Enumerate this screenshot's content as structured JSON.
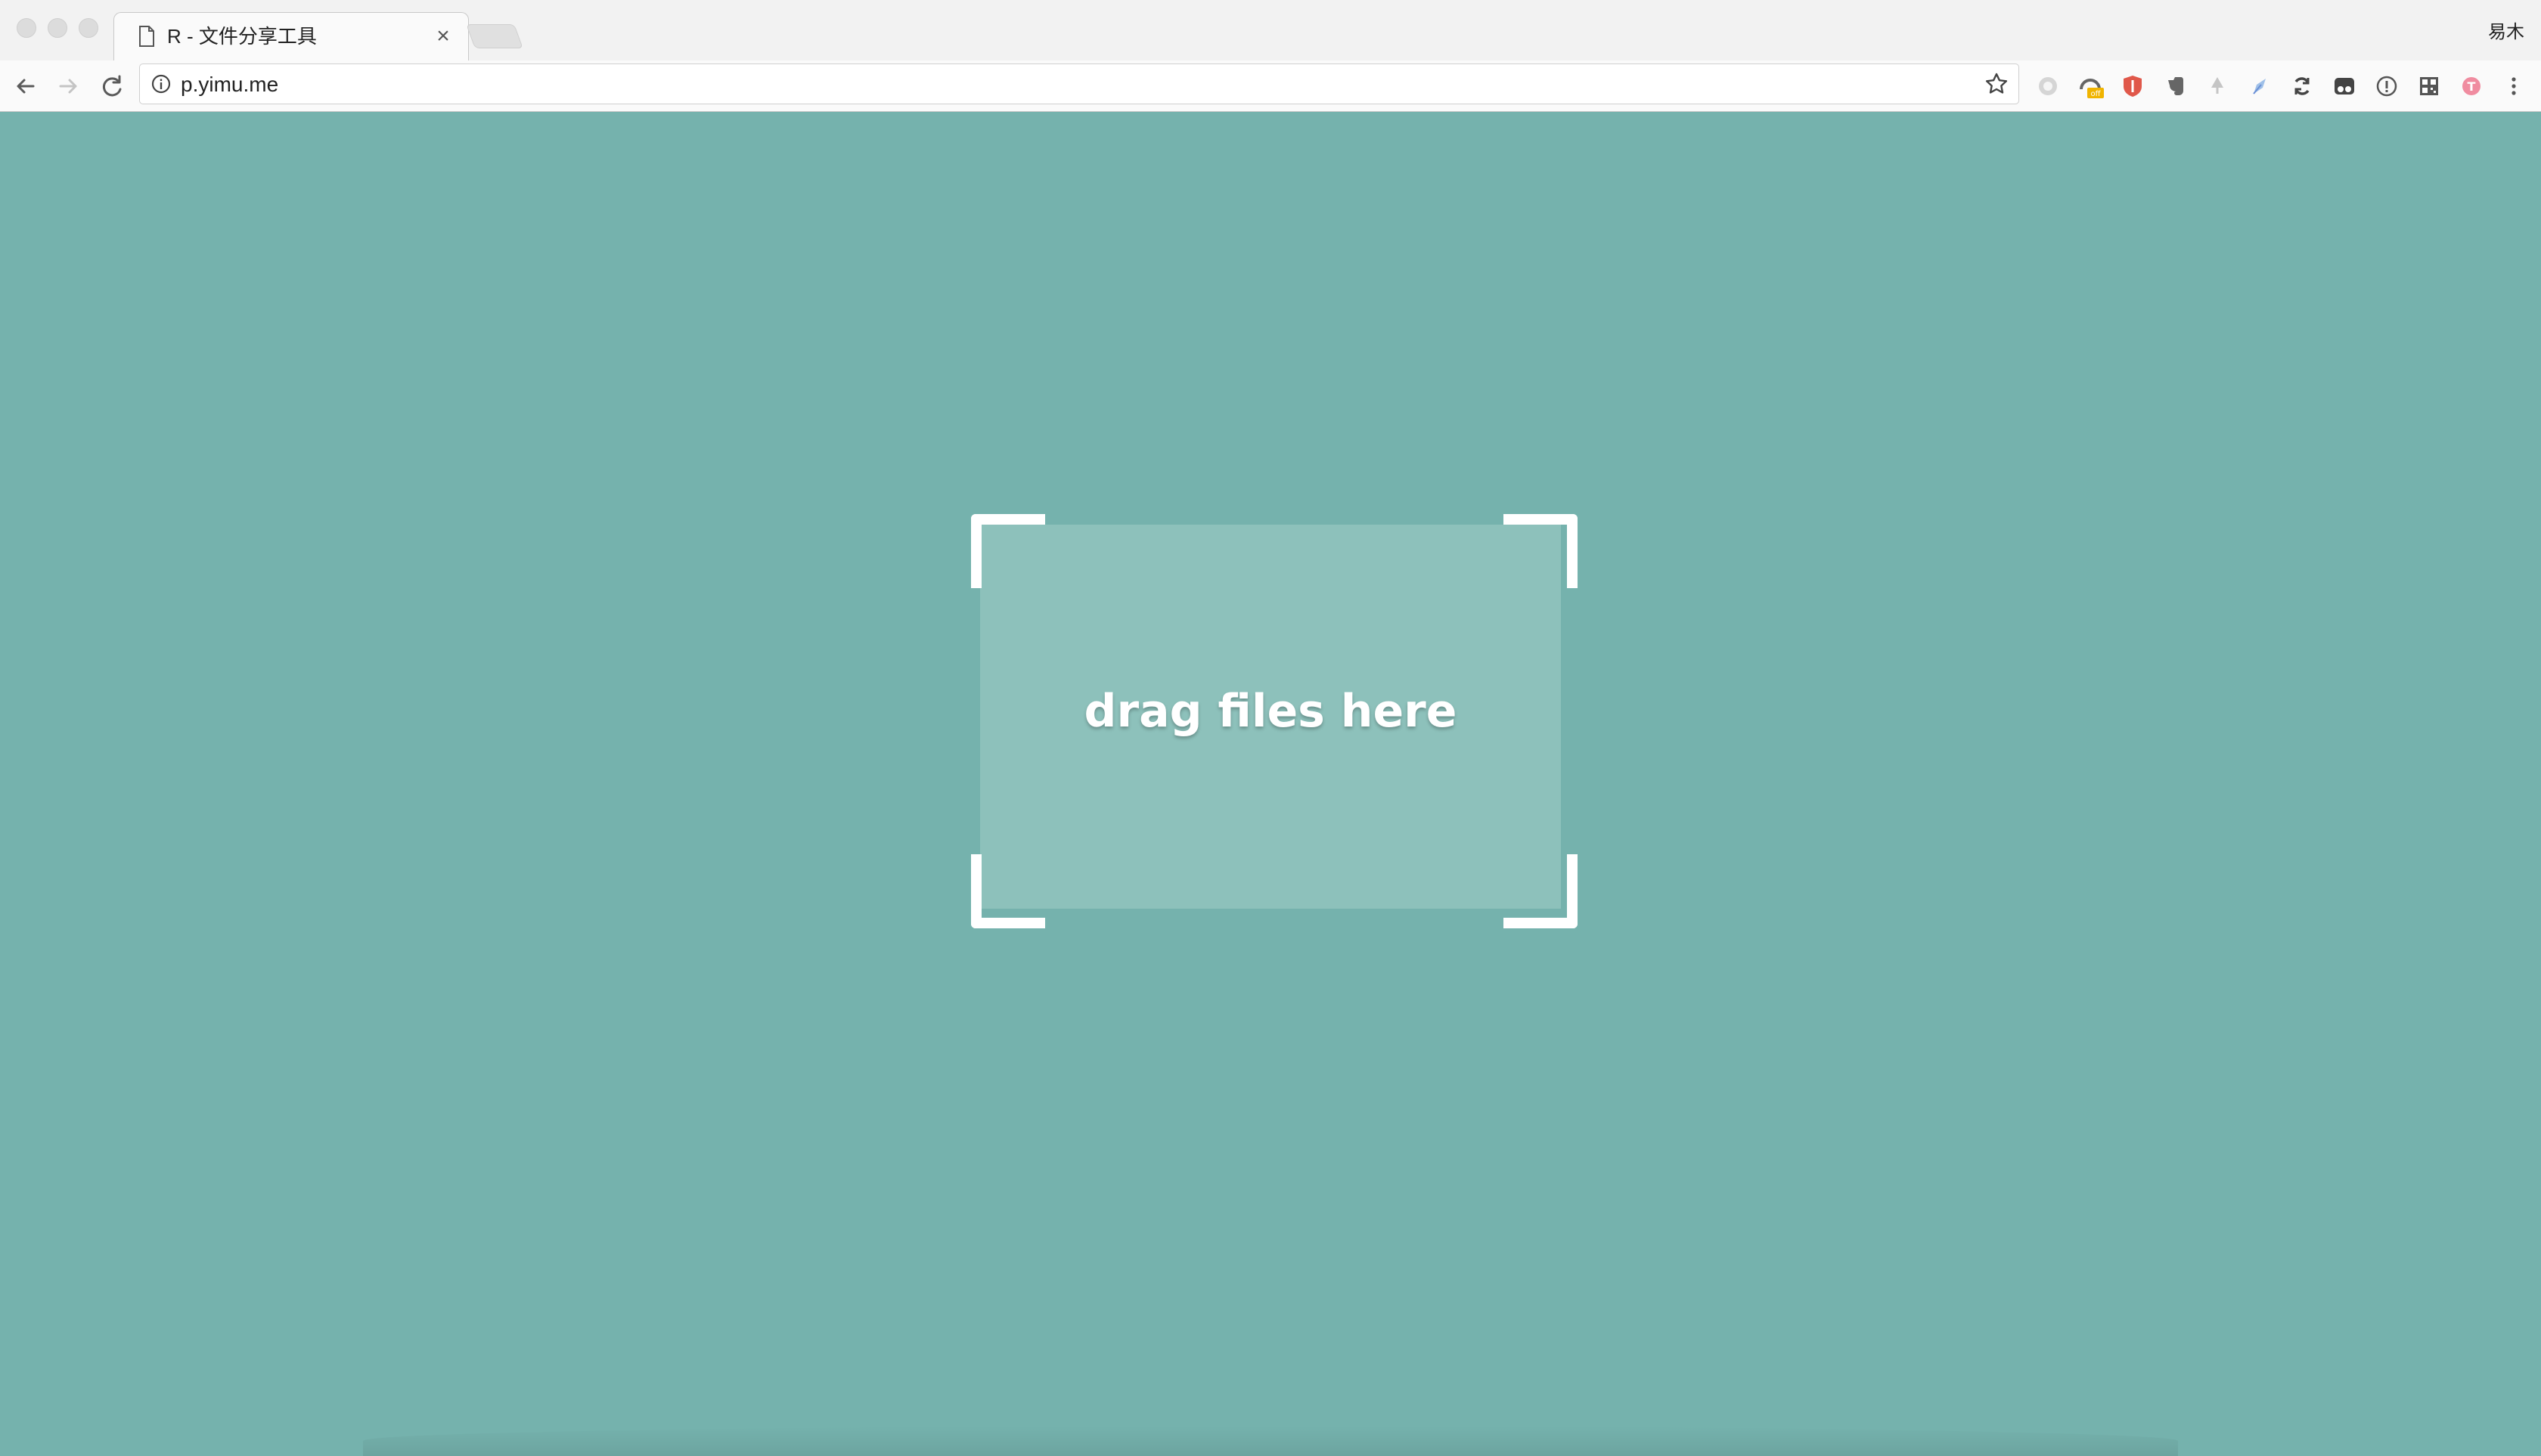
{
  "browser": {
    "tab": {
      "title": "R - 文件分享工具",
      "close_glyph": "×"
    },
    "profile_name": "易木",
    "address_bar": {
      "url": "p.yimu.me"
    },
    "extensions": [
      {
        "name": "circle-extension-icon",
        "color": "#b5b5b5"
      },
      {
        "name": "off-badge-extension-icon",
        "color": "#f0b400",
        "badge": "off"
      },
      {
        "name": "shield-extension-icon",
        "color": "#e0584a"
      },
      {
        "name": "evernote-elephant-icon",
        "color": "#666666"
      },
      {
        "name": "tree-extension-icon",
        "color": "#b0b0b0"
      },
      {
        "name": "pen-extension-icon",
        "color": "#6a8fd6"
      },
      {
        "name": "sync-extension-icon",
        "color": "#444444"
      },
      {
        "name": "tampermonkey-icon",
        "color": "#444444"
      },
      {
        "name": "info-circle-extension-icon",
        "color": "#555555"
      },
      {
        "name": "qr-code-extension-icon",
        "color": "#555555"
      },
      {
        "name": "user-avatar-extension-icon",
        "color": "#f08ca0"
      },
      {
        "name": "more-menu-icon",
        "color": "#555555"
      }
    ]
  },
  "page": {
    "background_color": "#75b2ad",
    "drop_zone": {
      "label": "drag files here",
      "fill_color": "#8dc1bb"
    }
  }
}
